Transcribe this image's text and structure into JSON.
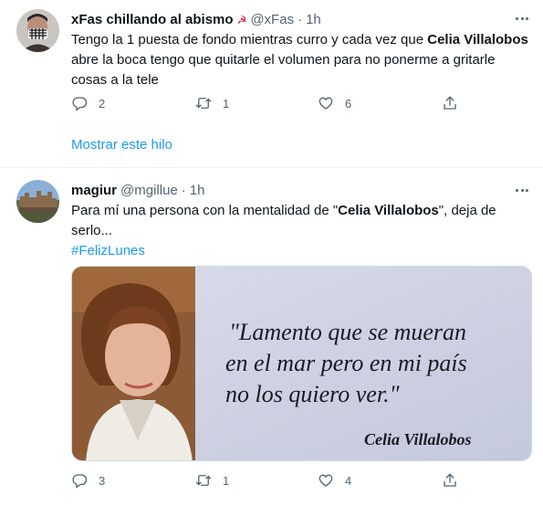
{
  "tweets": [
    {
      "author_name": "xFas chillando al abismo",
      "flag_icon": "hammer-sickle",
      "handle": "@xFas",
      "separator": "·",
      "time": "1h",
      "text_parts": [
        "Tengo la 1 puesta de fondo mientras curro y cada vez que ",
        "Celia Villalobos",
        " abre la boca tengo que quitarle el volumen para no ponerme a gritarle cosas a la tele"
      ],
      "reply_count": "2",
      "retweet_count": "1",
      "like_count": "6",
      "show_thread": "Mostrar este hilo"
    },
    {
      "author_name": "magiur",
      "handle": "@mgillue",
      "separator": "·",
      "time": "1h",
      "text_parts": [
        "Para mí una persona con la mentalidad de \"",
        "Celia Villalobos",
        "\", deja de serlo..."
      ],
      "hashtag": "#FelizLunes",
      "image_quote_lines": [
        "\"Lamento que se mueran",
        "en el mar pero en mi país",
        "no los quiero ver.\""
      ],
      "image_signature": "Celia Villalobos",
      "reply_count": "3",
      "retweet_count": "1",
      "like_count": "4"
    }
  ],
  "colors": {
    "accent": "#1d9bf0",
    "muted": "#536471",
    "text": "#0f1419",
    "divider": "#eff3f4"
  }
}
